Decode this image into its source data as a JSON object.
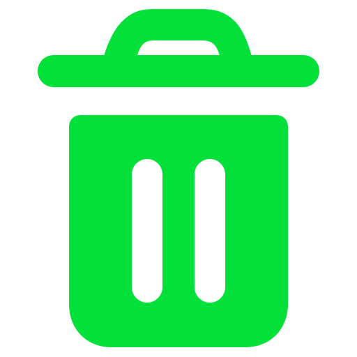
{
  "icon": {
    "name": "trash-icon",
    "color": "#04E03A",
    "background": "#FFFFFF"
  }
}
